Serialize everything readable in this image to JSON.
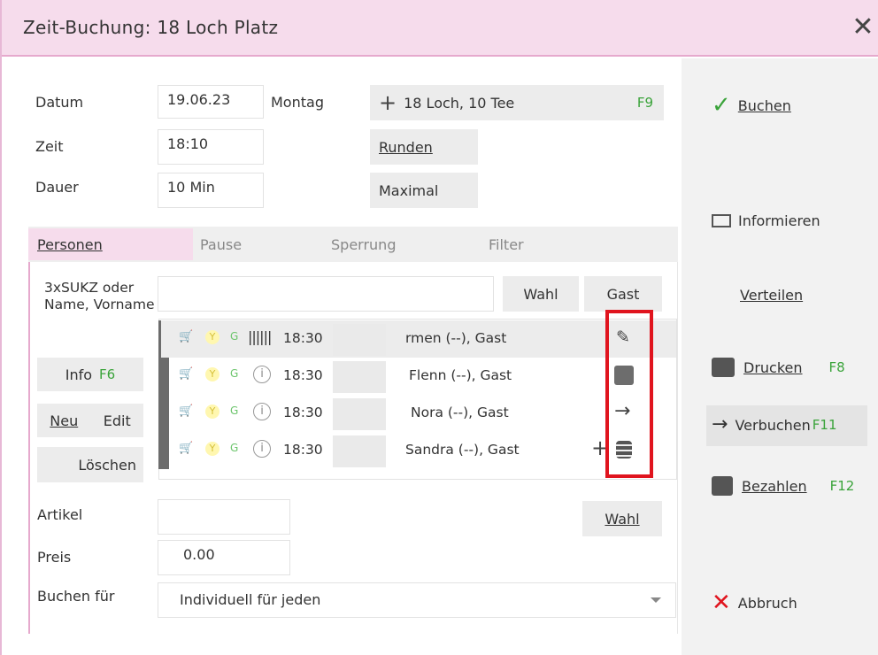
{
  "window": {
    "title": "Zeit-Buchung: 18 Loch Platz",
    "close_glyph": "✕"
  },
  "form": {
    "datum_label": "Datum",
    "datum_value": "19.06.23",
    "weekday": "Montag",
    "zeit_label": "Zeit",
    "zeit_value": "18:10",
    "dauer_label": "Dauer",
    "dauer_value": "10 Min",
    "course_button": "18 Loch, 10 Tee",
    "course_key": "F9",
    "runden_button": "Runden",
    "maximal_button": "Maximal"
  },
  "tabs": [
    {
      "label": "Personen",
      "active": true
    },
    {
      "label": "Pause",
      "active": false
    },
    {
      "label": "Sperrung",
      "active": false
    },
    {
      "label": "Filter",
      "active": false
    }
  ],
  "personen": {
    "search_label": "3xSUKZ oder Name, Vorname",
    "search_value": "",
    "wahl_button": "Wahl",
    "gast_button": "Gast",
    "info_button": "Info",
    "info_key": "F6",
    "neu_button": "Neu",
    "edit_button": "Edit",
    "loeschen_button": "Löschen",
    "rows": [
      {
        "time": "18:30",
        "name": "rmen (--), Gast",
        "action_icon": "edit-icon"
      },
      {
        "time": "18:30",
        "name": "Flenn (--), Gast",
        "action_icon": "cash-register-icon"
      },
      {
        "time": "18:30",
        "name": "Nora (--), Gast",
        "action_icon": "arrow-right-icon"
      },
      {
        "time": "18:30",
        "name": "Sandra (--), Gast",
        "action_icon": "coins-icon"
      }
    ],
    "artikel_label": "Artikel",
    "artikel_value": "",
    "artikel_wahl_button": "Wahl",
    "preis_label": "Preis",
    "preis_value": "0.00",
    "buchen_fuer_label": "Buchen für",
    "buchen_fuer_value": "Individuell für jeden"
  },
  "actions": {
    "buchen": "Buchen",
    "informieren": "Informieren",
    "verteilen": "Verteilen",
    "drucken": "Drucken",
    "drucken_key": "F8",
    "verbuchen": "Verbuchen",
    "verbuchen_key": "F11",
    "bezahlen": "Bezahlen",
    "bezahlen_key": "F12",
    "abbruch": "Abbruch"
  },
  "colors": {
    "accent_pink": "#e6a9cd",
    "title_bg": "#f6dcec",
    "highlight_red": "#e0141e",
    "key_green": "#3aa33a"
  }
}
